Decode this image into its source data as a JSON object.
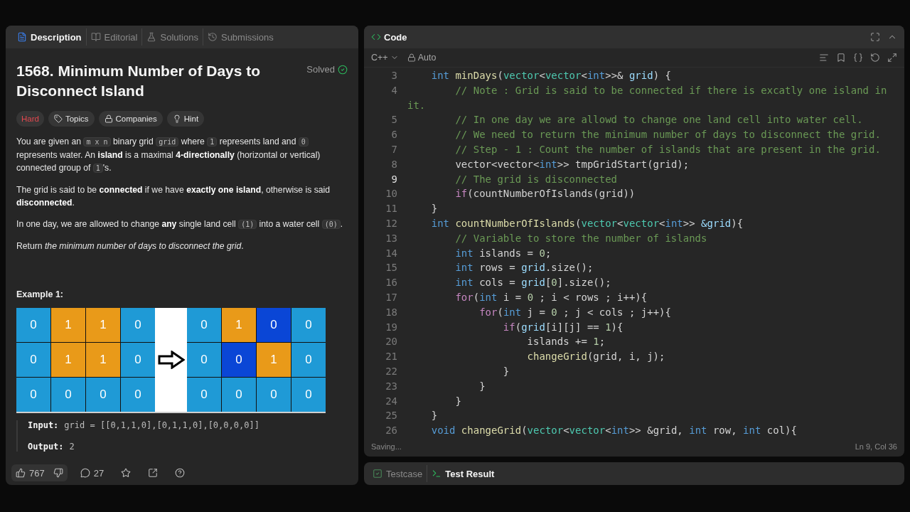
{
  "left_tabs": [
    {
      "label": "Description",
      "selected": true
    },
    {
      "label": "Editorial",
      "selected": false
    },
    {
      "label": "Solutions",
      "selected": false
    },
    {
      "label": "Submissions",
      "selected": false
    }
  ],
  "problem": {
    "title": "1568. Minimum Number of Days to Disconnect Island",
    "status": "Solved",
    "difficulty": "Hard",
    "tags": [
      {
        "label": "Topics"
      },
      {
        "label": "Companies"
      },
      {
        "label": "Hint"
      }
    ],
    "paragraphs": [
      [
        {
          "kind": "text",
          "text": "You are given an "
        },
        {
          "kind": "code",
          "text": "m x n"
        },
        {
          "kind": "text",
          "text": " binary grid "
        },
        {
          "kind": "code",
          "text": "grid"
        },
        {
          "kind": "text",
          "text": " where "
        },
        {
          "kind": "code",
          "text": "1"
        },
        {
          "kind": "text",
          "text": " represents land and "
        },
        {
          "kind": "code",
          "text": "0"
        },
        {
          "kind": "text",
          "text": " represents water. An **island** is a maximal **4-directionally** (horizontal or vertical) connected group of "
        },
        {
          "kind": "code",
          "text": "1"
        },
        {
          "kind": "text",
          "text": "'s."
        }
      ],
      [
        {
          "kind": "text",
          "text": "The grid is said to be **connected** if we have **exactly one island**, otherwise is said **disconnected**."
        }
      ],
      [
        {
          "kind": "text",
          "text": "In one day, we are allowed to change **any** single land cell "
        },
        {
          "kind": "code",
          "text": "(1)"
        },
        {
          "kind": "text",
          "text": " into a water cell "
        },
        {
          "kind": "code",
          "text": "(0)"
        },
        {
          "kind": "text",
          "text": "."
        }
      ],
      [
        {
          "kind": "text",
          "text": "Return *the minimum number of days to disconnect the grid*."
        }
      ]
    ],
    "example": {
      "title": "Example 1:",
      "before": [
        [
          {
            "value": "0",
            "kind": "water"
          },
          {
            "value": "1",
            "kind": "land"
          },
          {
            "value": "1",
            "kind": "land"
          },
          {
            "value": "0",
            "kind": "water"
          }
        ],
        [
          {
            "value": "0",
            "kind": "water"
          },
          {
            "value": "1",
            "kind": "land"
          },
          {
            "value": "1",
            "kind": "land"
          },
          {
            "value": "0",
            "kind": "water"
          }
        ],
        [
          {
            "value": "0",
            "kind": "water"
          },
          {
            "value": "0",
            "kind": "water"
          },
          {
            "value": "0",
            "kind": "water"
          },
          {
            "value": "0",
            "kind": "water"
          }
        ]
      ],
      "after": [
        [
          {
            "value": "0",
            "kind": "water"
          },
          {
            "value": "1",
            "kind": "land"
          },
          {
            "value": "0",
            "kind": "changed"
          },
          {
            "value": "0",
            "kind": "water"
          }
        ],
        [
          {
            "value": "0",
            "kind": "water"
          },
          {
            "value": "0",
            "kind": "changed"
          },
          {
            "value": "1",
            "kind": "land"
          },
          {
            "value": "0",
            "kind": "water"
          }
        ],
        [
          {
            "value": "0",
            "kind": "water"
          },
          {
            "value": "0",
            "kind": "water"
          },
          {
            "value": "0",
            "kind": "water"
          },
          {
            "value": "0",
            "kind": "water"
          }
        ]
      ],
      "input_label": "Input:",
      "input": "grid = [[0,1,1,0],[0,1,1,0],[0,0,0,0]]",
      "output_label": "Output:",
      "output": "2"
    }
  },
  "footer": {
    "likes": "767",
    "comments": "27"
  },
  "code_panel": {
    "title": "Code",
    "language": "C++",
    "mode": "Auto",
    "status": "Saving...",
    "cursor": "Ln 9, Col 36",
    "lines": [
      {
        "number": "3",
        "current": false,
        "tokens": [
          {
            "kind": "type",
            "text": "    int"
          },
          {
            "kind": "fn",
            "text": " minDays"
          },
          {
            "kind": "plain",
            "text": "("
          },
          {
            "kind": "class",
            "text": "vector"
          },
          {
            "kind": "plain",
            "text": "<"
          },
          {
            "kind": "class",
            "text": "vector"
          },
          {
            "kind": "plain",
            "text": "<"
          },
          {
            "kind": "type",
            "text": "int"
          },
          {
            "kind": "plain",
            "text": ">>& "
          },
          {
            "kind": "var",
            "text": "grid"
          },
          {
            "kind": "plain",
            "text": ") {"
          }
        ]
      },
      {
        "number": "4",
        "current": false,
        "tokens": [
          {
            "kind": "comment",
            "text": "        // Note : Grid is said to be connected if there is excatly one island in it."
          }
        ]
      },
      {
        "number": "5",
        "current": false,
        "tokens": [
          {
            "kind": "comment",
            "text": "        // In one day we are allowd to change one land cell into water cell."
          }
        ]
      },
      {
        "number": "6",
        "current": false,
        "tokens": [
          {
            "kind": "comment",
            "text": "        // We need to return the minimum number of days to disconnect the grid."
          }
        ]
      },
      {
        "number": "7",
        "current": false,
        "tokens": [
          {
            "kind": "comment",
            "text": "        // Step - 1 : Count the number of islands that are present in the grid."
          }
        ]
      },
      {
        "number": "8",
        "current": false,
        "tokens": [
          {
            "kind": "plain",
            "text": "        vector<vector<"
          },
          {
            "kind": "type",
            "text": "int"
          },
          {
            "kind": "plain",
            "text": ">> tmpGridStart(grid);"
          }
        ]
      },
      {
        "number": "9",
        "current": true,
        "tokens": [
          {
            "kind": "comment",
            "text": "        // The grid is disconnected"
          }
        ]
      },
      {
        "number": "10",
        "current": false,
        "tokens": [
          {
            "kind": "control",
            "text": "        if"
          },
          {
            "kind": "plain",
            "text": "(countNumberOfIslands(grid))"
          }
        ]
      },
      {
        "number": "11",
        "current": false,
        "tokens": [
          {
            "kind": "plain",
            "text": "    }"
          }
        ]
      },
      {
        "number": "12",
        "current": false,
        "tokens": [
          {
            "kind": "type",
            "text": "    int"
          },
          {
            "kind": "fn",
            "text": " countNumberOfIslands"
          },
          {
            "kind": "plain",
            "text": "("
          },
          {
            "kind": "class",
            "text": "vector"
          },
          {
            "kind": "plain",
            "text": "<"
          },
          {
            "kind": "class",
            "text": "vector"
          },
          {
            "kind": "plain",
            "text": "<"
          },
          {
            "kind": "type",
            "text": "int"
          },
          {
            "kind": "plain",
            "text": ">> "
          },
          {
            "kind": "var",
            "text": "&grid"
          },
          {
            "kind": "plain",
            "text": "){"
          }
        ]
      },
      {
        "number": "13",
        "current": false,
        "tokens": [
          {
            "kind": "comment",
            "text": "        // Variable to store the number of islands"
          }
        ]
      },
      {
        "number": "14",
        "current": false,
        "tokens": [
          {
            "kind": "type",
            "text": "        int"
          },
          {
            "kind": "plain",
            "text": " islands = "
          },
          {
            "kind": "number",
            "text": "0"
          },
          {
            "kind": "plain",
            "text": ";"
          }
        ]
      },
      {
        "number": "15",
        "current": false,
        "tokens": [
          {
            "kind": "type",
            "text": "        int"
          },
          {
            "kind": "plain",
            "text": " rows = "
          },
          {
            "kind": "var",
            "text": "grid"
          },
          {
            "kind": "plain",
            "text": ".size();"
          }
        ]
      },
      {
        "number": "16",
        "current": false,
        "tokens": [
          {
            "kind": "type",
            "text": "        int"
          },
          {
            "kind": "plain",
            "text": " cols = "
          },
          {
            "kind": "var",
            "text": "grid"
          },
          {
            "kind": "plain",
            "text": "["
          },
          {
            "kind": "number",
            "text": "0"
          },
          {
            "kind": "plain",
            "text": "].size();"
          }
        ]
      },
      {
        "number": "17",
        "current": false,
        "tokens": [
          {
            "kind": "control",
            "text": "        for"
          },
          {
            "kind": "plain",
            "text": "("
          },
          {
            "kind": "type",
            "text": "int"
          },
          {
            "kind": "plain",
            "text": " i = "
          },
          {
            "kind": "number",
            "text": "0"
          },
          {
            "kind": "plain",
            "text": " ; i < rows ; i++){"
          }
        ]
      },
      {
        "number": "18",
        "current": false,
        "tokens": [
          {
            "kind": "control",
            "text": "            for"
          },
          {
            "kind": "plain",
            "text": "("
          },
          {
            "kind": "type",
            "text": "int"
          },
          {
            "kind": "plain",
            "text": " j = "
          },
          {
            "kind": "number",
            "text": "0"
          },
          {
            "kind": "plain",
            "text": " ; j < cols ; j++){"
          }
        ]
      },
      {
        "number": "19",
        "current": false,
        "tokens": [
          {
            "kind": "control",
            "text": "                if"
          },
          {
            "kind": "plain",
            "text": "("
          },
          {
            "kind": "var",
            "text": "grid"
          },
          {
            "kind": "plain",
            "text": "[i][j] == "
          },
          {
            "kind": "number",
            "text": "1"
          },
          {
            "kind": "plain",
            "text": "){"
          }
        ]
      },
      {
        "number": "20",
        "current": false,
        "tokens": [
          {
            "kind": "plain",
            "text": "                    islands += "
          },
          {
            "kind": "number",
            "text": "1"
          },
          {
            "kind": "plain",
            "text": ";"
          }
        ]
      },
      {
        "number": "21",
        "current": false,
        "tokens": [
          {
            "kind": "fn",
            "text": "                    changeGrid"
          },
          {
            "kind": "plain",
            "text": "(grid, i, j);"
          }
        ]
      },
      {
        "number": "22",
        "current": false,
        "tokens": [
          {
            "kind": "plain",
            "text": "                }"
          }
        ]
      },
      {
        "number": "23",
        "current": false,
        "tokens": [
          {
            "kind": "plain",
            "text": "            }"
          }
        ]
      },
      {
        "number": "24",
        "current": false,
        "tokens": [
          {
            "kind": "plain",
            "text": "        }"
          }
        ]
      },
      {
        "number": "25",
        "current": false,
        "tokens": [
          {
            "kind": "plain",
            "text": "    }"
          }
        ]
      },
      {
        "number": "26",
        "current": false,
        "tokens": [
          {
            "kind": "type",
            "text": "    void"
          },
          {
            "kind": "fn",
            "text": " changeGrid"
          },
          {
            "kind": "plain",
            "text": "("
          },
          {
            "kind": "class",
            "text": "vector"
          },
          {
            "kind": "plain",
            "text": "<"
          },
          {
            "kind": "class",
            "text": "vector"
          },
          {
            "kind": "plain",
            "text": "<"
          },
          {
            "kind": "type",
            "text": "int"
          },
          {
            "kind": "plain",
            "text": ">> &grid, "
          },
          {
            "kind": "type",
            "text": "int"
          },
          {
            "kind": "plain",
            "text": " row, "
          },
          {
            "kind": "type",
            "text": "int"
          },
          {
            "kind": "plain",
            "text": " col){"
          }
        ]
      }
    ]
  },
  "bottom_tabs": [
    {
      "label": "Testcase",
      "selected": false
    },
    {
      "label": "Test Result",
      "selected": true
    }
  ]
}
